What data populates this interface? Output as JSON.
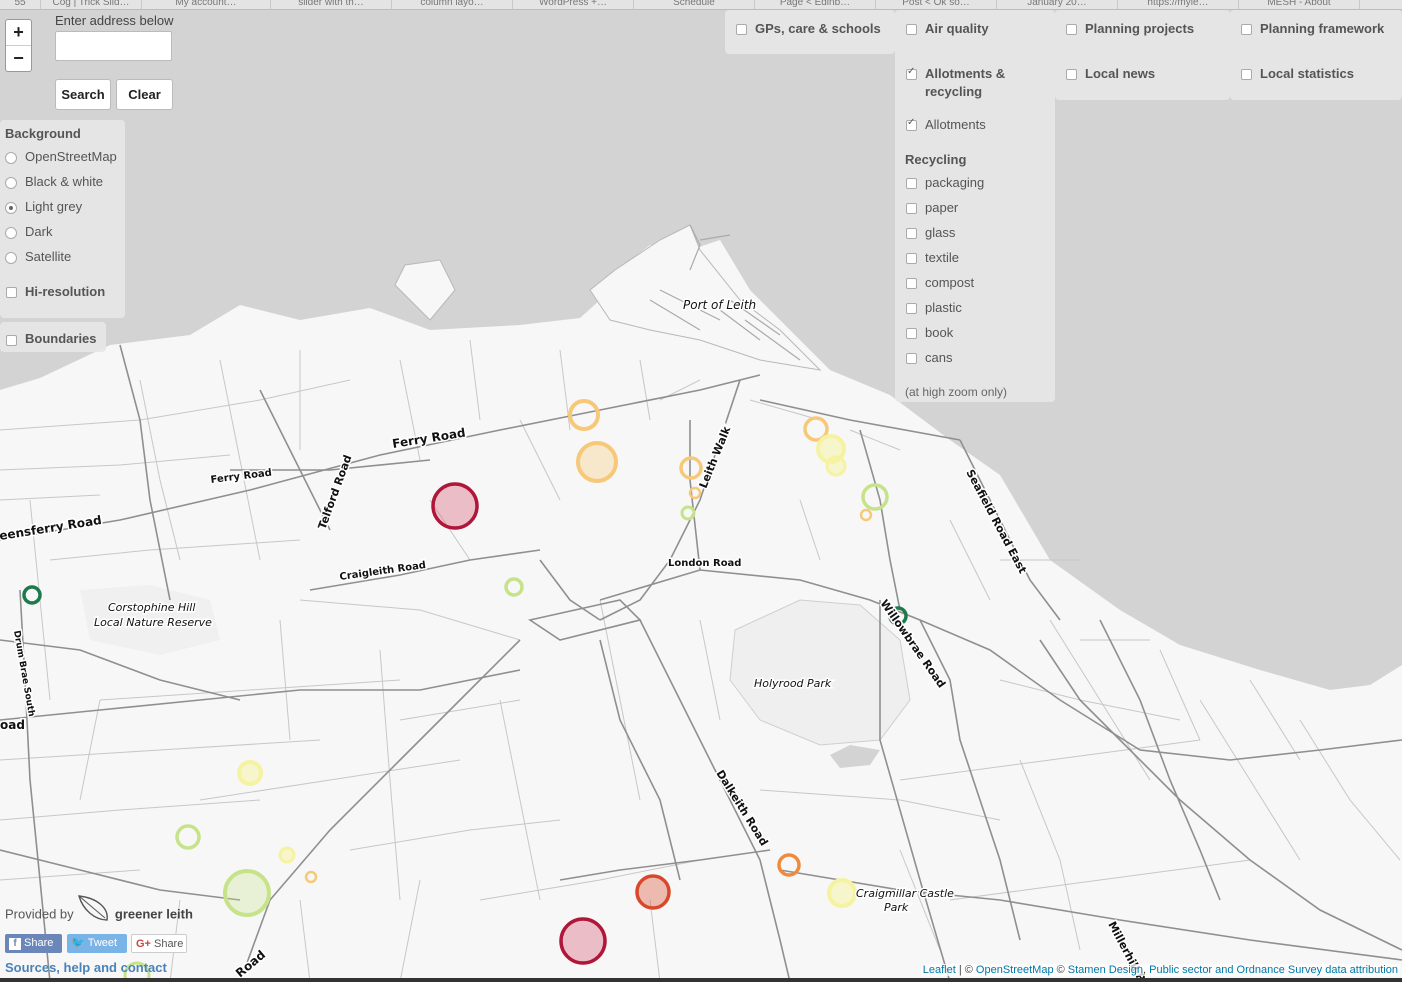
{
  "browser_tabs": [
    "55",
    "Cog | Trick Slid…",
    "My account…",
    "slider with th…",
    "column layo…",
    "WordPress +…",
    "Schedule",
    "Page < Edinb…",
    "Post < Ok so…",
    "January 20…",
    "https://myle…",
    "MESH - About"
  ],
  "zoom": {
    "in_label": "+",
    "out_label": "−"
  },
  "search": {
    "label": "Enter address below",
    "value": "",
    "search_label": "Search",
    "clear_label": "Clear"
  },
  "background_panel": {
    "title": "Background",
    "options": [
      {
        "label": "OpenStreetMap",
        "selected": false
      },
      {
        "label": "Black & white",
        "selected": false
      },
      {
        "label": "Light grey",
        "selected": true
      },
      {
        "label": "Dark",
        "selected": false
      },
      {
        "label": "Satellite",
        "selected": false
      }
    ],
    "hires_label": "Hi-resolution"
  },
  "boundaries_label": "Boundaries",
  "layers": {
    "gps": "GPs, care & schools",
    "air_quality": "Air quality",
    "allotments_recycling": [
      "Allotments &",
      "recycling"
    ],
    "allotments": "Allotments",
    "recycling_title": "Recycling",
    "recycling_items": [
      "packaging",
      "paper",
      "glass",
      "textile",
      "compost",
      "plastic",
      "book",
      "cans"
    ],
    "recycling_note": "(at high zoom only)",
    "planning_projects": "Planning projects",
    "local_news": "Local news",
    "planning_framework": "Planning framework",
    "local_statistics": "Local statistics"
  },
  "map_labels": [
    "Port of Leith",
    "Ferry Road",
    "Ferry Road",
    "Telford Road",
    "eensferry Road",
    "Craigleith Road",
    "Corstophine Hill",
    "Local Nature Reserve",
    "Drum Brae South",
    "Leith Walk",
    "London Road",
    "Seafield Road East",
    "Willowbrae Road",
    "Holyrood Park",
    "Dalkeith Road",
    "Craigmillar Castle",
    "Park",
    "Millerhill R",
    "Road",
    "oad"
  ],
  "credit": {
    "provided_by": "Provided by",
    "brand": "greener leith"
  },
  "share_buttons": {
    "facebook": "Share",
    "twitter": "Tweet",
    "google": "Share"
  },
  "sources_link": "Sources, help and contact",
  "attribution": {
    "leaflet": "Leaflet",
    "sep1": " | © ",
    "osm": "OpenStreetMap",
    "sep2": " © ",
    "stamen": "Stamen Design",
    "sep3": ", ",
    "public": "Public sector and Ordnance Survey data attribution"
  },
  "colors": {
    "sea": "#d3d3d3",
    "land": "#f7f7f7",
    "road": "#8f8f8f",
    "dark_red": "#b0163a",
    "red_orange": "#d9482b",
    "orange": "#f08a3c",
    "light_orange": "#f7c878",
    "yellow": "#f6f3a0",
    "light_green": "#c6e38a",
    "dark_green": "#1e7a4a"
  }
}
